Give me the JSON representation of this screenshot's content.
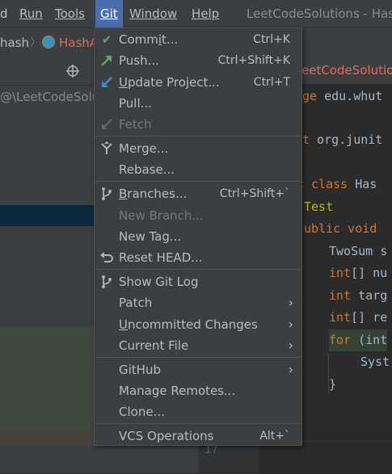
{
  "menubar": {
    "items": [
      "d",
      "Run",
      "Tools",
      "Git",
      "Window",
      "Help"
    ],
    "title": "LeetCodeSolutions - Has"
  },
  "navbar": {
    "crumb1": "hash",
    "crumb2": "HashA"
  },
  "project_panel": {
    "path": "@\\LeetCodeSolut"
  },
  "editor": {
    "tab": "eetCodeSolution",
    "lines": [
      {
        "kw": "ge",
        "rest": " edu.whut"
      },
      {
        "kw": "t",
        "rest": " org.junit"
      },
      {
        "kw": "c class",
        "rest": " Has"
      },
      {
        "ann": "Test",
        "rest": ""
      },
      {
        "kw": "ublic void",
        "rest": " "
      },
      {
        "kw": "",
        "rest": "TwoSum s"
      },
      {
        "kw": "int",
        "rest": "[] nu"
      },
      {
        "kw": "int",
        "rest": " targ"
      },
      {
        "kw": "int",
        "rest": "[] re"
      },
      {
        "kw": "for",
        "rest": " (int"
      },
      {
        "kw": "",
        "rest": "Syst"
      },
      {
        "kw": "",
        "rest": "}"
      }
    ],
    "line_number": "17"
  },
  "git_menu": {
    "items": [
      {
        "label_pre": "Comm",
        "label_u": "i",
        "label_post": "t...",
        "shortcut": "Ctrl+K",
        "icon": "check-icon"
      },
      {
        "label_pre": "Push...",
        "label_u": "",
        "label_post": "",
        "shortcut": "Ctrl+Shift+K",
        "icon": "push-arrow-icon"
      },
      {
        "label_pre": "",
        "label_u": "U",
        "label_post": "pdate Project...",
        "shortcut": "Ctrl+T",
        "icon": "update-arrow-icon"
      },
      {
        "label_pre": "Pull...",
        "label_u": "",
        "label_post": "",
        "shortcut": "",
        "icon": ""
      },
      {
        "label_pre": "Fetch",
        "label_u": "",
        "label_post": "",
        "shortcut": "",
        "icon": "fetch-arrow-icon",
        "disabled": true
      },
      {
        "label_pre": "Merge...",
        "label_u": "",
        "label_post": "",
        "shortcut": "",
        "icon": "merge-icon"
      },
      {
        "label_pre": "Rebase...",
        "label_u": "",
        "label_post": "",
        "shortcut": "",
        "icon": ""
      },
      {
        "label_pre": "",
        "label_u": "B",
        "label_post": "ranches...",
        "shortcut": "Ctrl+Shift+`",
        "icon": "branch-icon"
      },
      {
        "label_pre": "New Branch...",
        "label_u": "",
        "label_post": "",
        "shortcut": "",
        "icon": "",
        "disabled": true
      },
      {
        "label_pre": "New Tag...",
        "label_u": "",
        "label_post": "",
        "shortcut": "",
        "icon": ""
      },
      {
        "label_pre": "Reset HEAD...",
        "label_u": "",
        "label_post": "",
        "shortcut": "",
        "icon": "reset-icon"
      },
      {
        "label_pre": "Show Git Log",
        "label_u": "",
        "label_post": "",
        "shortcut": "",
        "icon": "git-log-icon"
      },
      {
        "label_pre": "Patch",
        "label_u": "",
        "label_post": "",
        "shortcut": "",
        "icon": "",
        "submenu": true
      },
      {
        "label_pre": "",
        "label_u": "U",
        "label_post": "ncommitted Changes",
        "shortcut": "",
        "icon": "",
        "submenu": true
      },
      {
        "label_pre": "Current File",
        "label_u": "",
        "label_post": "",
        "shortcut": "",
        "icon": "",
        "submenu": true
      },
      {
        "label_pre": "GitHub",
        "label_u": "",
        "label_post": "",
        "shortcut": "",
        "icon": "",
        "submenu": true
      },
      {
        "label_pre": "Manage Remotes...",
        "label_u": "",
        "label_post": "",
        "shortcut": "",
        "icon": ""
      },
      {
        "label_pre": "Clone...",
        "label_u": "",
        "label_post": "",
        "shortcut": "",
        "icon": ""
      },
      {
        "label_pre": "VCS Operations",
        "label_u": "",
        "label_post": "",
        "shortcut": "Alt+`",
        "icon": ""
      }
    ]
  }
}
